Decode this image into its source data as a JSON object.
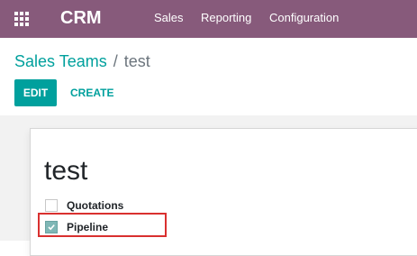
{
  "navbar": {
    "apps_icon": "grid-icon",
    "brand": "CRM",
    "menu": [
      "Sales",
      "Reporting",
      "Configuration"
    ],
    "background": "#875a7b"
  },
  "breadcrumb": {
    "parent": "Sales Teams",
    "separator": "/",
    "current": "test"
  },
  "actions": {
    "edit_label": "EDIT",
    "create_label": "CREATE"
  },
  "form": {
    "title": "test",
    "checkboxes": [
      {
        "label": "Quotations",
        "checked": false
      },
      {
        "label": "Pipeline",
        "checked": true
      }
    ]
  },
  "colors": {
    "accent": "#00a09d",
    "highlight": "#d9302f"
  }
}
